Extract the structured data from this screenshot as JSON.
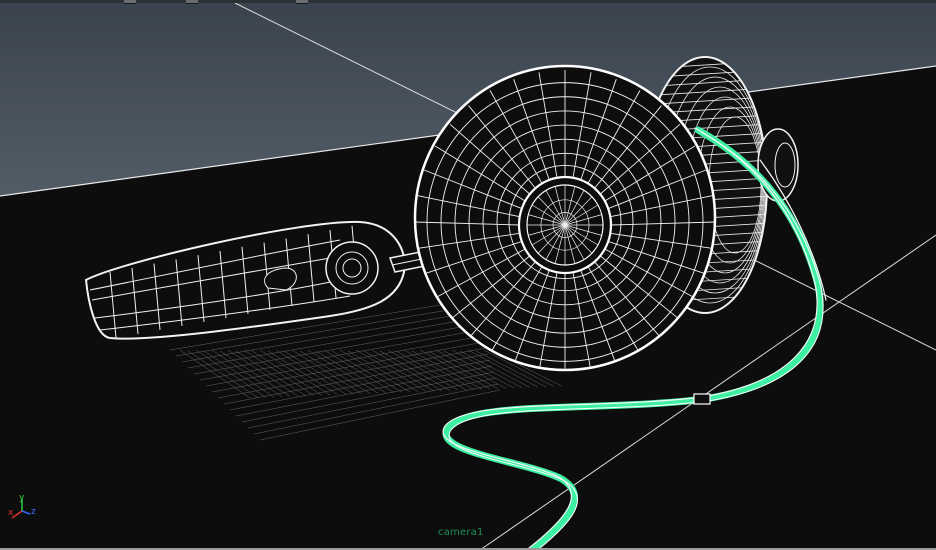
{
  "viewport": {
    "camera_label": "camera1",
    "axis": {
      "x_label": "x",
      "y_label": "y",
      "z_label": "z"
    },
    "colors": {
      "sky": "#46505b",
      "ground": "#0d0d0d",
      "wire": "#f2f2f2",
      "cable": "#3df0a2",
      "camera_label": "#1d8f55",
      "axis_x": "#e03030",
      "axis_y": "#2fd03a",
      "axis_z": "#3a6cff"
    }
  },
  "toolbar": {
    "icons": [
      "panel-icon",
      "panel-icon",
      "panel-icon"
    ]
  }
}
